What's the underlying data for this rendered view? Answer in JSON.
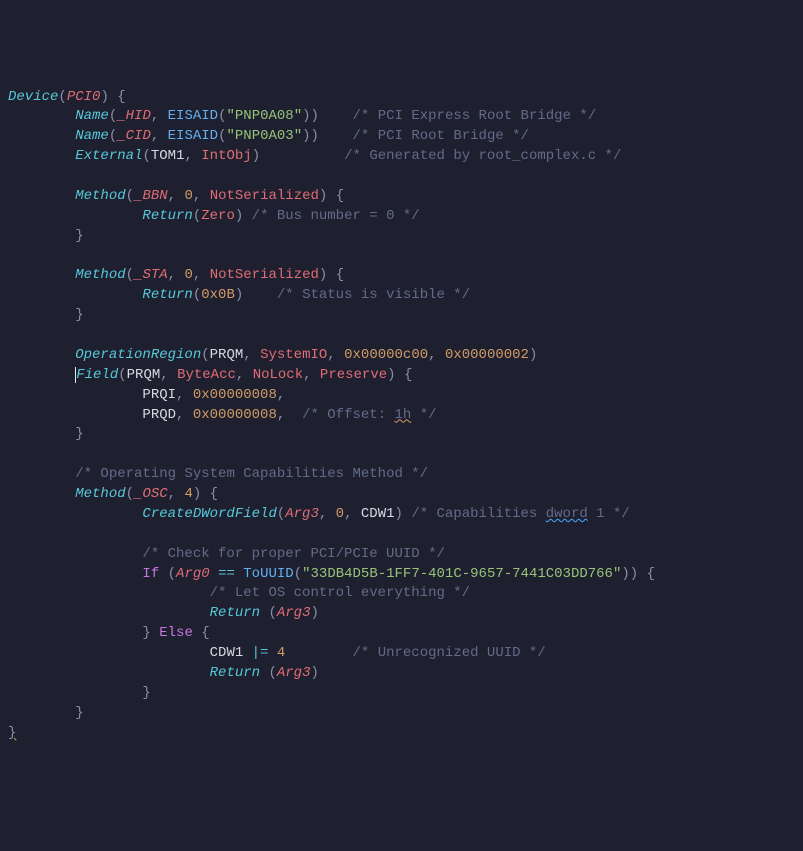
{
  "l1": {
    "device": "Device",
    "pci0": "PCI0"
  },
  "l2": {
    "name": "Name",
    "hid": "_HID",
    "eisaid": "EISAID",
    "s": "\"PNP0A08\"",
    "c": "/* PCI Express Root Bridge */"
  },
  "l3": {
    "name": "Name",
    "cid": "_CID",
    "eisaid": "EISAID",
    "s": "\"PNP0A03\"",
    "c": "/* PCI Root Bridge */"
  },
  "l4": {
    "external": "External",
    "tom1": "TOM1",
    "intobj": "IntObj",
    "c": "/* Generated by root_complex.c */"
  },
  "l6": {
    "method": "Method",
    "bbn": "_BBN",
    "n": "0",
    "ns": "NotSerialized"
  },
  "l7": {
    "return": "Return",
    "zero": "Zero",
    "c": "/* Bus number = 0 */"
  },
  "l10": {
    "method": "Method",
    "sta": "_STA",
    "n": "0",
    "ns": "NotSerialized"
  },
  "l11": {
    "return": "Return",
    "hex": "0x0B",
    "c": "/* Status is visible */"
  },
  "l14": {
    "or": "OperationRegion",
    "prqm": "PRQM",
    "sio": "SystemIO",
    "h1": "0x00000c00",
    "h2": "0x00000002"
  },
  "l15": {
    "field": "Field",
    "prqm": "PRQM",
    "ba": "ByteAcc",
    "nl": "NoLock",
    "pr": "Preserve"
  },
  "l16": {
    "prqi": "PRQI",
    "h": "0x00000008"
  },
  "l17": {
    "prqd": "PRQD",
    "h": "0x00000008",
    "c1": "/* Offset: ",
    "c2": "1h",
    "c3": " */"
  },
  "l20": {
    "c": "/* Operating System Capabilities Method */"
  },
  "l21": {
    "method": "Method",
    "osc": "_OSC",
    "n": "4"
  },
  "l22": {
    "cdw": "CreateDWordField",
    "arg3": "Arg3",
    "n": "0",
    "cdw1": "CDW1",
    "c1": "/* Capabilities ",
    "c2": "dword",
    "c3": " 1 */"
  },
  "l24": {
    "c": "/* Check for proper PCI/PCIe UUID */"
  },
  "l25": {
    "if": "If",
    "arg0": "Arg0",
    "eq": "==",
    "touuid": "ToUUID",
    "s": "\"33DB4D5B-1FF7-401C-9657-7441C03DD766\""
  },
  "l26": {
    "c": "/* Let OS control everything */"
  },
  "l27": {
    "return": "Return",
    "arg3": "Arg3"
  },
  "l28": {
    "else": "Else"
  },
  "l29": {
    "cdw1": "CDW1",
    "op": "|=",
    "n": "4",
    "c": "/* Unrecognized UUID */"
  },
  "l30": {
    "return": "Return",
    "arg3": "Arg3"
  }
}
